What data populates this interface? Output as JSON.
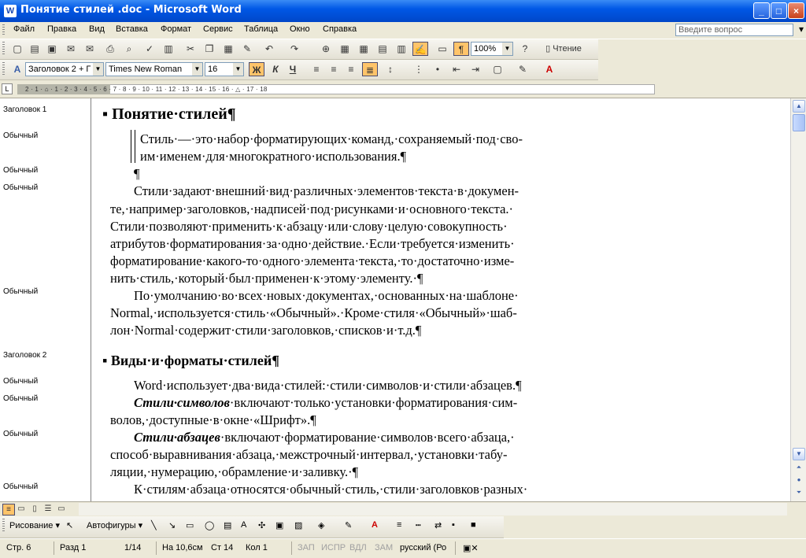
{
  "window": {
    "title": "Понятие стилей .doc - Microsoft Word",
    "minimize": "_",
    "maximize": "□",
    "close": "×"
  },
  "menu": {
    "items": [
      "Файл",
      "Правка",
      "Вид",
      "Вставка",
      "Формат",
      "Сервис",
      "Таблица",
      "Окно",
      "Справка"
    ],
    "help_placeholder": "Введите вопрос"
  },
  "standard_toolbar": {
    "zoom": "100%",
    "reading_label": "Чтение"
  },
  "formatting_toolbar": {
    "style": "Заголовок 2 + Г",
    "font": "Times New Roman",
    "size": "16",
    "bold": "Ж",
    "italic": "К",
    "underline": "Ч"
  },
  "ruler": {
    "labels": "2 · 1 · ⌂ · 1 · 2 · 3 · 4 · 5 · 6 · 7 · 8 · 9 · 10 · 11 · 12 · 13 · 14 · 15 · 16 · △ · 17 · 18"
  },
  "style_pane": [
    "Заголовок 1",
    "Обычный",
    "Обычный",
    "Обычный",
    "Обычный",
    "Заголовок 2",
    "Обычный",
    "Обычный",
    "Обычный",
    "Обычный"
  ],
  "document": {
    "heading1": "Понятие·стилей¶",
    "quote_l1": "Стиль·—·это·набор·форматирующих·команд,·сохраняемый·под·сво-",
    "quote_l2": "им·именем·для·многократного·использования.¶",
    "empty_para": "¶",
    "p1_l1": "Стили·задают·внешний·вид·различных·элементов·текста·в·докумен-",
    "p1_l2": "те,·например·заголовков,·надписей·под·рисунками·и·основного·текста.·",
    "p1_l3": "Стили·позволяют·применить·к·абзацу·или·слову·целую·совокупность·",
    "p1_l4": "атрибутов·форматирования·за·одно·действие.·Если·требуется·изменить·",
    "p1_l5": "форматирование·какого-то·одного·элемента·текста,·то·достаточно·изме-",
    "p1_l6": "нить·стиль,·который·был·применен·к·этому·элементу.·¶",
    "p2_l1": "По·умолчанию·во·всех·новых·документах,·основанных·на·шаблоне·",
    "p2_l2": "Normal,·используется·стиль·«Обычный».·Кроме·стиля·«Обычный»·шаб-",
    "p2_l3": "лон·Normal·содержит·стили·заголовков,·списков·и·т.д.¶",
    "heading2": "Виды·и·форматы·стилей¶",
    "p3": "Word·использует·два·вида·стилей:·стили·символов·и·стили·абзацев.¶",
    "p4_em": "Стили·символов",
    "p4_l1": "·включают·только·установки·форматирования·сим-",
    "p4_l2": "волов,·доступные·в·окне·«Шрифт».¶",
    "p5_em": "Стили·абзацев",
    "p5_l1": "·включают·форматирование·символов·всего·абзаца,·",
    "p5_l2": "способ·выравнивания·абзаца,·межстрочный·интервал,·установки·табу-",
    "p5_l3": "ляции,·нумерацию,·обрамление·и·заливку.·¶",
    "p6_l1": "К·стилям·абзаца·относятся·обычный·стиль,·стили·заголовков·разных·"
  },
  "drawing_toolbar": {
    "drawing": "Рисование ▾",
    "autoshapes": "Автофигуры ▾"
  },
  "status": {
    "page": "Стр.  6",
    "section": "Разд  1",
    "pages": "1/14",
    "at": "На 10,6см",
    "line": "Ст  14",
    "col": "Кол  1",
    "rec": "ЗАП",
    "trk": "ИСПР",
    "ext": "ВДЛ",
    "ovr": "ЗАМ",
    "lang": "русский (Ро"
  }
}
